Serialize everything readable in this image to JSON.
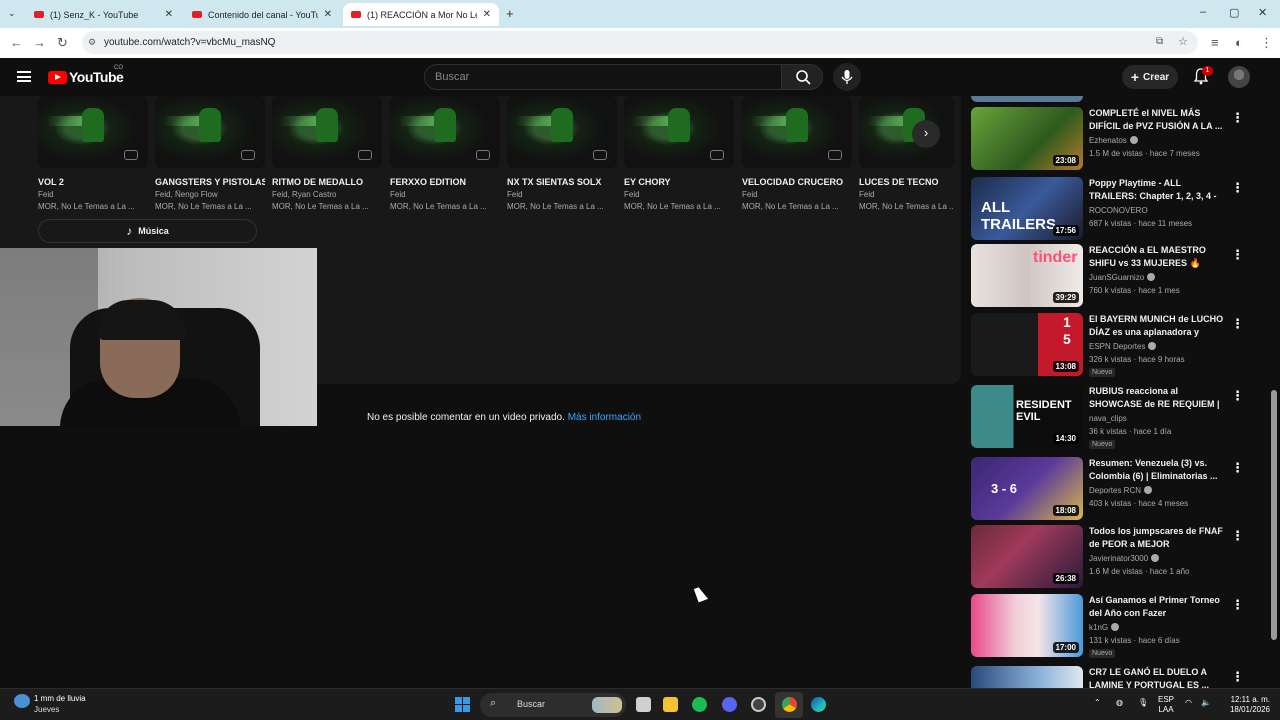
{
  "browser": {
    "tabs": [
      {
        "label": "(1) Senz_K - YouTube",
        "active": false
      },
      {
        "label": "Contenido del canal - YouTube",
        "active": false
      },
      {
        "label": "(1) REACCIÓN a Mor No Le Temas",
        "active": true
      }
    ],
    "new_tab": "+",
    "url": "youtube.com/watch?v=vbcMu_masNQ",
    "window_controls": [
      "–",
      "▢",
      "✕"
    ]
  },
  "header": {
    "logo_text": "YouTube",
    "country_code": "CO",
    "search_placeholder": "Buscar",
    "create_label": "Crear",
    "notif_count": "1"
  },
  "playlist": {
    "items": [
      {
        "title": "VOL 2",
        "artist": "Feid",
        "album": "MOR, No Le Temas a La ..."
      },
      {
        "title": "GANGSTERS Y PISTOLAS",
        "artist": "Feid, Ñengo Flow",
        "album": "MOR, No Le Temas a La ..."
      },
      {
        "title": "RITMO DE MEDALLO",
        "artist": "Feid, Ryan Castro",
        "album": "MOR, No Le Temas a La ..."
      },
      {
        "title": "FERXXO EDITION",
        "artist": "Feid",
        "album": "MOR, No Le Temas a La ..."
      },
      {
        "title": "NX TX SIENTAS SOLX",
        "artist": "Feid",
        "album": "MOR, No Le Temas a La ..."
      },
      {
        "title": "EY CHORY",
        "artist": "Feid",
        "album": "MOR, No Le Temas a La ..."
      },
      {
        "title": "VELOCIDAD CRUCERO",
        "artist": "Feid",
        "album": "MOR, No Le Temas a La ..."
      },
      {
        "title": "LUCES DE TECNO",
        "artist": "Feid",
        "album": "MOR, No Le Temas a La ..."
      }
    ],
    "music_button": "Música"
  },
  "comments": {
    "private_msg": "No es posible comentar en un video privado.",
    "more_info": "Más información"
  },
  "recommendations": [
    {
      "title": "COMPLETÉ el NIVEL MÁS DIFÍCIL de PVZ FUSIÓN A LA ...",
      "channel": "Ezhenatos",
      "meta": "1.5 M de vistas · hace 7 meses",
      "duration": "23:08",
      "new": "",
      "thumb": "#3b7a2a"
    },
    {
      "title": "Poppy Playtime - ALL TRAILERS: Chapter 1, 2, 3, 4 - ...",
      "channel": "ROCONOVERO",
      "meta": "687 k vistas · hace 11 meses",
      "duration": "17:56",
      "new": "",
      "thumb": "#2a3f6b"
    },
    {
      "title": "REACCIÓN a EL MAESTRO SHIFU vs 33 MUJERES 🔥",
      "channel": "JuanSGuarnizo",
      "meta": "760 k vistas · hace 1 mes",
      "duration": "39:29",
      "new": "",
      "thumb": "#d9d2cf"
    },
    {
      "title": "El BAYERN MUNICH de LUCHO DÍAZ es una aplanadora y gole...",
      "channel": "ESPN Deportes",
      "meta": "326 k vistas · hace 9 horas",
      "duration": "13:08",
      "new": "Nuevo",
      "thumb": "#b51d2a"
    },
    {
      "title": "RUBIUS reacciona al SHOWCASE de RE REQUIEM | ...",
      "channel": "nava_clips",
      "meta": "36 k vistas · hace 1 día",
      "duration": "14:30",
      "new": "Nuevo",
      "thumb": "#3a6b6b"
    },
    {
      "title": "Resumen: Venezuela (3) vs. Colombia (6) | Eliminatorias ...",
      "channel": "Deportes RCN",
      "meta": "403 k vistas · hace 4 meses",
      "duration": "18:08",
      "new": "",
      "thumb": "#4a2d7a"
    },
    {
      "title": "Todos los jumpscares de FNAF de PEOR a MEJOR",
      "channel": "Javierinator3000",
      "meta": "1.6 M de vistas · hace 1 año",
      "duration": "26:38",
      "new": "",
      "thumb": "#5a2d3a"
    },
    {
      "title": "Así Ganamos el Primer Torneo del Año con Fazer",
      "channel": "k1nG",
      "meta": "131 k vistas · hace 6 días",
      "duration": "17:00",
      "new": "Nuevo",
      "thumb": "#d94a7a"
    },
    {
      "title": "CR7 LE GANÓ EL DUELO A LAMINE Y PORTUGAL ES ...",
      "channel": "",
      "meta": "",
      "duration": "",
      "new": "",
      "thumb": "#3a5a8a"
    }
  ],
  "taskbar": {
    "weather_line1": "1 mm de lluvia",
    "weather_line2": "Jueves",
    "search": "Buscar",
    "lang1": "ESP",
    "lang2": "LAA",
    "time": "12:11 a. m.",
    "date": "18/01/2026"
  }
}
